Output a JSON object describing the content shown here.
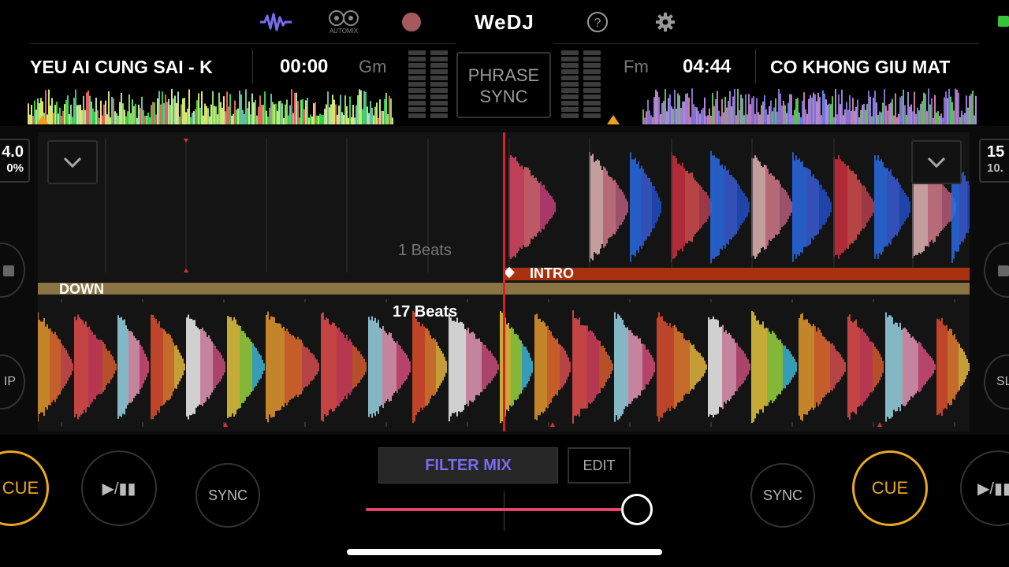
{
  "header": {
    "brand": "WeDJ",
    "automix_label": "AUTOMIX",
    "icons": [
      "waveform-icon",
      "automix-icon",
      "record-icon",
      "help-icon",
      "gear-icon",
      "battery-icon"
    ]
  },
  "deck_left": {
    "title": "YEU AI CUNG SAI - K",
    "time": "00:00",
    "key": "Gm",
    "bpm_partial": "4.0",
    "pitch_partial": "0%",
    "side_btn_partial": "IP"
  },
  "deck_right": {
    "title": "CO KHONG GIU MAT",
    "time": "04:44",
    "key": "Fm",
    "bpm_partial": "15",
    "pitch_partial": "10.",
    "side_btn_partial": "SL"
  },
  "center": {
    "phrase_sync_line1": "PHRASE",
    "phrase_sync_line2": "SYNC"
  },
  "waveform": {
    "upper_beats_label": "1 Beats",
    "upper_phrase_label": "INTRO",
    "lower_phrase_label": "DOWN",
    "lower_beats_label": "17 Beats"
  },
  "transport": {
    "cue_label": "CUE",
    "play_pause_label": "▶/▮▮",
    "sync_label": "SYNC",
    "filter_mix_label": "FILTER MIX",
    "edit_label": "EDIT",
    "crossfader_value": 1.0
  },
  "colors": {
    "accent_purple": "#7a6cf0",
    "cue_orange": "#e8a820",
    "playhead_red": "#e01b24",
    "crossfader_pink": "#e8416e",
    "intro_bar": "#a83210",
    "down_bar": "#8a7444"
  }
}
